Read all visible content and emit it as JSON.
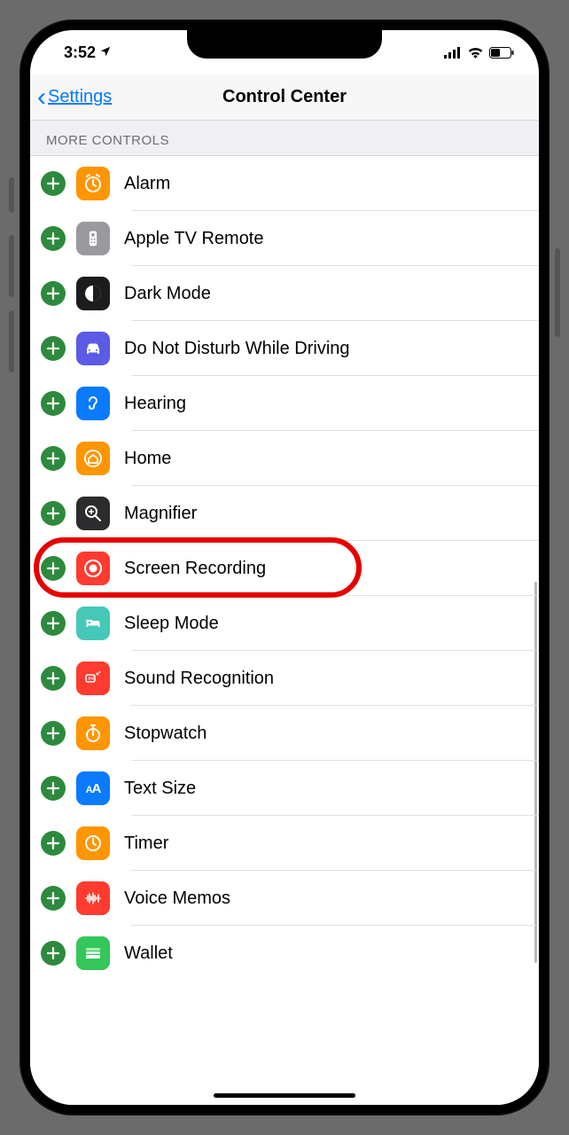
{
  "status": {
    "time": "3:52",
    "location_icon": "location-arrow"
  },
  "nav": {
    "back_label": "Settings",
    "title": "Control Center"
  },
  "section": {
    "more_controls": "MORE CONTROLS"
  },
  "items": [
    {
      "label": "Alarm",
      "icon": "alarm-icon",
      "bg": "#ff9500"
    },
    {
      "label": "Apple TV Remote",
      "icon": "remote-icon",
      "bg": "#9a9a9e"
    },
    {
      "label": "Dark Mode",
      "icon": "darkmode-icon",
      "bg": "#1c1c1e"
    },
    {
      "label": "Do Not Disturb While Driving",
      "icon": "car-icon",
      "bg": "#5b5be6"
    },
    {
      "label": "Hearing",
      "icon": "ear-icon",
      "bg": "#0a7aff"
    },
    {
      "label": "Home",
      "icon": "home-icon",
      "bg": "#ff9500"
    },
    {
      "label": "Magnifier",
      "icon": "magnifier-icon",
      "bg": "#2c2c2e"
    },
    {
      "label": "Screen Recording",
      "icon": "record-icon",
      "bg": "#ff3b30",
      "highlight": true
    },
    {
      "label": "Sleep Mode",
      "icon": "bed-icon",
      "bg": "#46c8b8"
    },
    {
      "label": "Sound Recognition",
      "icon": "sound-icon",
      "bg": "#ff3b30"
    },
    {
      "label": "Stopwatch",
      "icon": "stopwatch-icon",
      "bg": "#ff9500"
    },
    {
      "label": "Text Size",
      "icon": "textsize-icon",
      "bg": "#0a7aff"
    },
    {
      "label": "Timer",
      "icon": "timer-icon",
      "bg": "#ff9500"
    },
    {
      "label": "Voice Memos",
      "icon": "voicememo-icon",
      "bg": "#ff3b30"
    },
    {
      "label": "Wallet",
      "icon": "wallet-icon",
      "bg": "#34c759"
    }
  ]
}
